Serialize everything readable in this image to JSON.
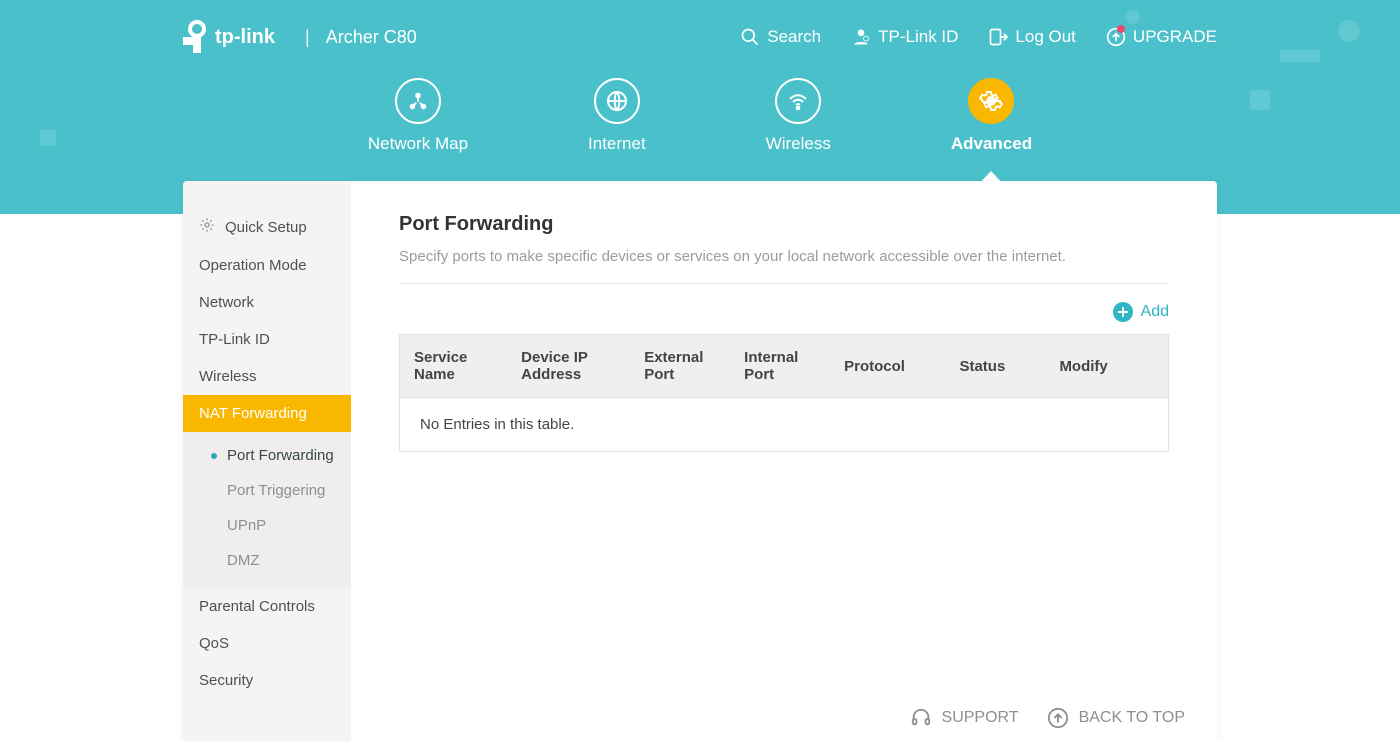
{
  "brand": {
    "name": "tp-link",
    "model": "Archer C80"
  },
  "top_actions": {
    "search": "Search",
    "tplink_id": "TP-Link ID",
    "logout": "Log Out",
    "upgrade": "UPGRADE"
  },
  "tabs": {
    "network_map": "Network Map",
    "internet": "Internet",
    "wireless": "Wireless",
    "advanced": "Advanced"
  },
  "sidebar": {
    "items": [
      {
        "label": "Quick Setup",
        "icon": "gear"
      },
      {
        "label": "Operation Mode"
      },
      {
        "label": "Network"
      },
      {
        "label": "TP-Link ID"
      },
      {
        "label": "Wireless"
      },
      {
        "label": "NAT Forwarding",
        "active": true,
        "children": [
          {
            "label": "Port Forwarding",
            "selected": true
          },
          {
            "label": "Port Triggering"
          },
          {
            "label": "UPnP"
          },
          {
            "label": "DMZ"
          }
        ]
      },
      {
        "label": "Parental Controls"
      },
      {
        "label": "QoS"
      },
      {
        "label": "Security"
      }
    ]
  },
  "page": {
    "title": "Port Forwarding",
    "description": "Specify ports to make specific devices or services on your local network accessible over the internet.",
    "add_label": "Add",
    "table_headers": [
      "Service Name",
      "Device IP Address",
      "External Port",
      "Internal Port",
      "Protocol",
      "Status",
      "Modify"
    ],
    "empty_message": "No Entries in this table."
  },
  "footer": {
    "support": "SUPPORT",
    "back_to_top": "BACK TO TOP"
  },
  "colors": {
    "teal": "#4ac1ca",
    "amber": "#f9b700",
    "accent": "#2fb6c2"
  }
}
